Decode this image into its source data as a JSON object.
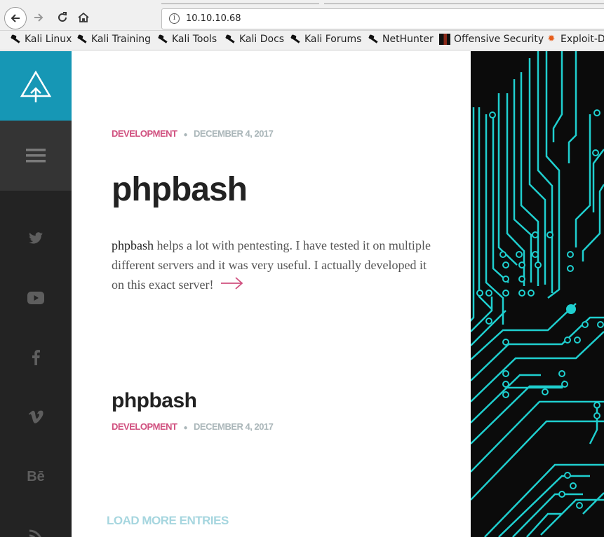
{
  "browser": {
    "url": "10.10.10.68",
    "bookmarks": [
      {
        "label": "Kali Linux",
        "icon": "kali-dragon-icon"
      },
      {
        "label": "Kali Training",
        "icon": "kali-dragon-icon"
      },
      {
        "label": "Kali Tools",
        "icon": "kali-dragon-icon"
      },
      {
        "label": "Kali Docs",
        "icon": "kali-dragon-icon"
      },
      {
        "label": "Kali Forums",
        "icon": "kali-dragon-icon"
      },
      {
        "label": "NetHunter",
        "icon": "kali-dragon-icon"
      },
      {
        "label": "Offensive Security",
        "icon": "offsec-icon"
      },
      {
        "label": "Exploit-D",
        "icon": "exploit-db-icon"
      }
    ]
  },
  "sidebar": {
    "accent_color": "#1697b5",
    "social": [
      {
        "name": "twitter-icon",
        "glyph": "🐦"
      },
      {
        "name": "youtube-icon",
        "glyph": "▶"
      },
      {
        "name": "facebook-icon",
        "glyph": "f"
      },
      {
        "name": "vimeo-icon",
        "glyph": "v"
      },
      {
        "name": "behance-icon",
        "glyph": "Bē"
      },
      {
        "name": "rss-icon",
        "glyph": ")"
      }
    ]
  },
  "posts": [
    {
      "category": "DEVELOPMENT",
      "date": "DECEMBER 4, 2017",
      "title": "phpbash",
      "excerpt_strong": "phpbash",
      "excerpt_rest": " helps a lot with pentesting. I have tested it on multiple different servers and it was very useful. I actually developed it on this exact server!"
    },
    {
      "category": "DEVELOPMENT",
      "date": "DECEMBER 4, 2017",
      "title": "phpbash"
    }
  ],
  "load_more": "LOAD MORE ENTRIES",
  "colors": {
    "category": "#d0507f",
    "date": "#aab6b9",
    "circuit": "#1fcfcf",
    "load_more": "#a6d6df"
  }
}
